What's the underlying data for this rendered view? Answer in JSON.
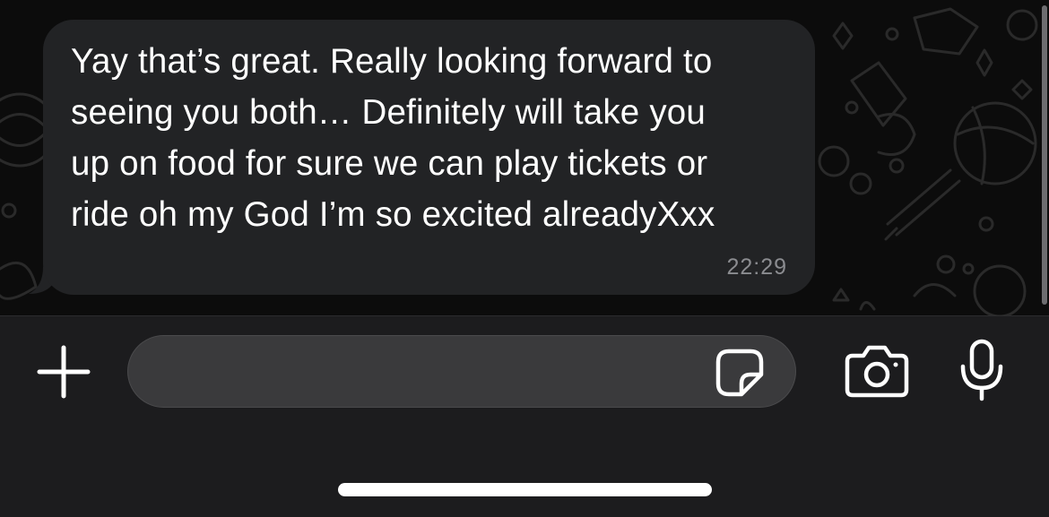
{
  "conversation": {
    "messages": [
      {
        "direction": "incoming",
        "text": "Yay that’s great. Really looking forward to\nseeing you both… Definitely will take you\nup on food for sure we can play tickets or\nride oh my God I’m so excited alreadyXxx",
        "time": "22:29"
      }
    ]
  },
  "composer": {
    "attach_icon": "plus-icon",
    "input_value": "",
    "input_placeholder": "",
    "sticker_icon": "sticker-icon",
    "camera_icon": "camera-icon",
    "mic_icon": "microphone-icon"
  },
  "colors": {
    "chat_background": "#0c0c0c",
    "bubble_incoming": "#222325",
    "input_bar": "#1c1c1e",
    "input_field": "#3a3a3c",
    "timestamp": "#8b8c90"
  }
}
